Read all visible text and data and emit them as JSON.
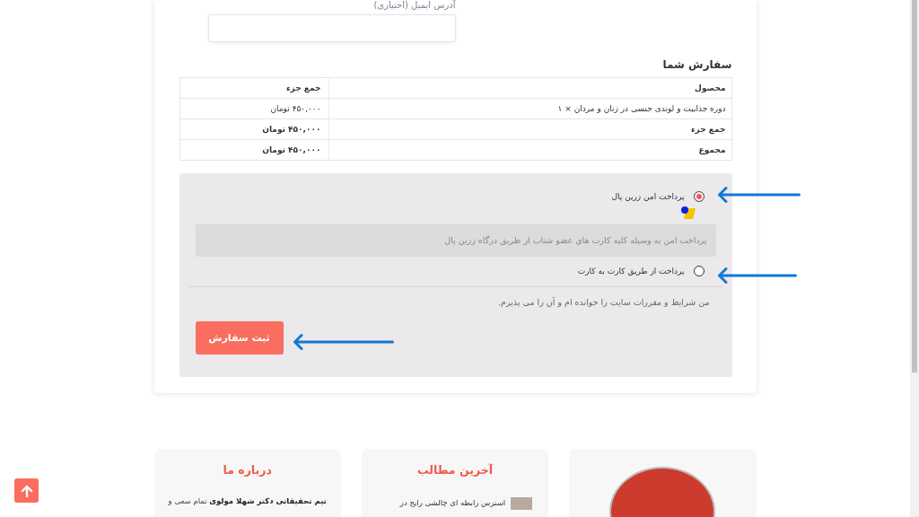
{
  "email": {
    "label": "آدرس ایمیل (اختیاری)"
  },
  "order": {
    "title": "سفارش شما",
    "columns": [
      "محصول",
      "جمع جزء"
    ],
    "rows": [
      {
        "kind": "item",
        "cells": [
          "دوره جذابیت و لوندی جنسی در زنان و مردان  × ۱",
          "۴۵۰,۰۰۰ تومان"
        ]
      },
      {
        "kind": "total",
        "cells": [
          "جمع جزء",
          "۴۵۰,۰۰۰ تومان"
        ]
      },
      {
        "kind": "total",
        "cells": [
          "مجموع",
          "۴۵۰,۰۰۰ تومان"
        ]
      }
    ]
  },
  "payment": {
    "methods": [
      {
        "label": "پرداخت امن زرین پال",
        "selected": true,
        "description": "پرداخت امن به وسیله کلیه کارت های عضو شتاب از طریق درگاه زرین پال"
      },
      {
        "label": "پرداخت از طریق کارت به کارت",
        "selected": false
      }
    ],
    "terms": "من شرایط و مقررات سایت را خوانده ام و آن را می پذیرم.",
    "submit": "ثبت سفارش"
  },
  "footer": [
    {
      "kind": "profile"
    },
    {
      "kind": "posts",
      "title": "آخرین مطالب",
      "post": "استرس رابطه ای چالشی رایج در"
    },
    {
      "kind": "about",
      "title": "درباره ما",
      "text": "**تیم تحقیقاتی دکتر شهلا مولوی** تمام سعی و"
    }
  ]
}
